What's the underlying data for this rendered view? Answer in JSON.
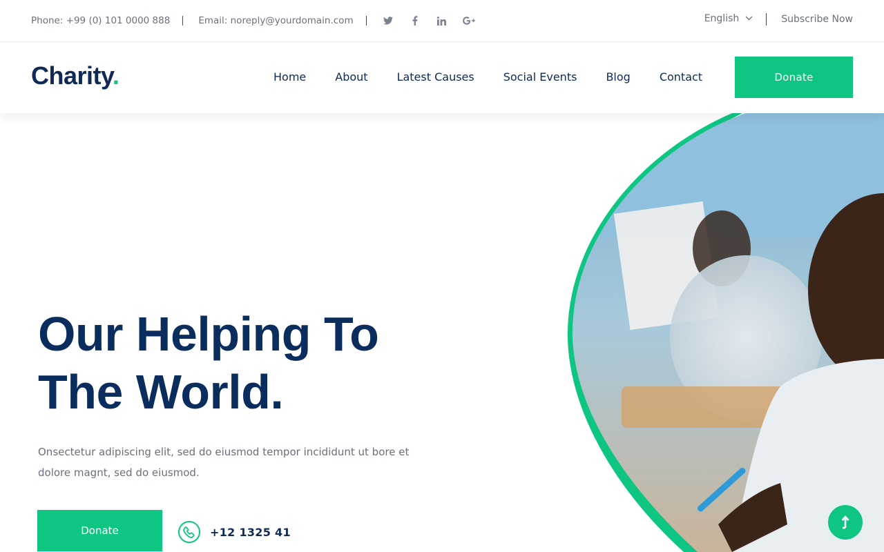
{
  "topbar": {
    "phone": "Phone: +99 (0) 101 0000 888",
    "email": "Email: noreply@yourdomain.com",
    "socials": [
      "twitter-icon",
      "facebook-icon",
      "linkedin-icon",
      "google-plus-icon"
    ],
    "language": "English",
    "subscribe": "Subscribe Now"
  },
  "header": {
    "logo": "Charity",
    "logo_dot": ".",
    "nav": [
      "Home",
      "About",
      "Latest Causes",
      "Social Events",
      "Blog",
      "Contact"
    ],
    "donate_label": "Donate"
  },
  "hero": {
    "title_line1": "Our Helping To",
    "title_line2": "The World.",
    "text": "Onsectetur adipiscing elit, sed do eiusmod tempor incididunt ut bore et dolore magnt, sed do eiusmod.",
    "donate_label": "Donate",
    "phone": "+12 1325 41"
  },
  "colors": {
    "accent": "#0ec582",
    "heading": "#0b2d5e",
    "text": "#6a6f7b"
  }
}
